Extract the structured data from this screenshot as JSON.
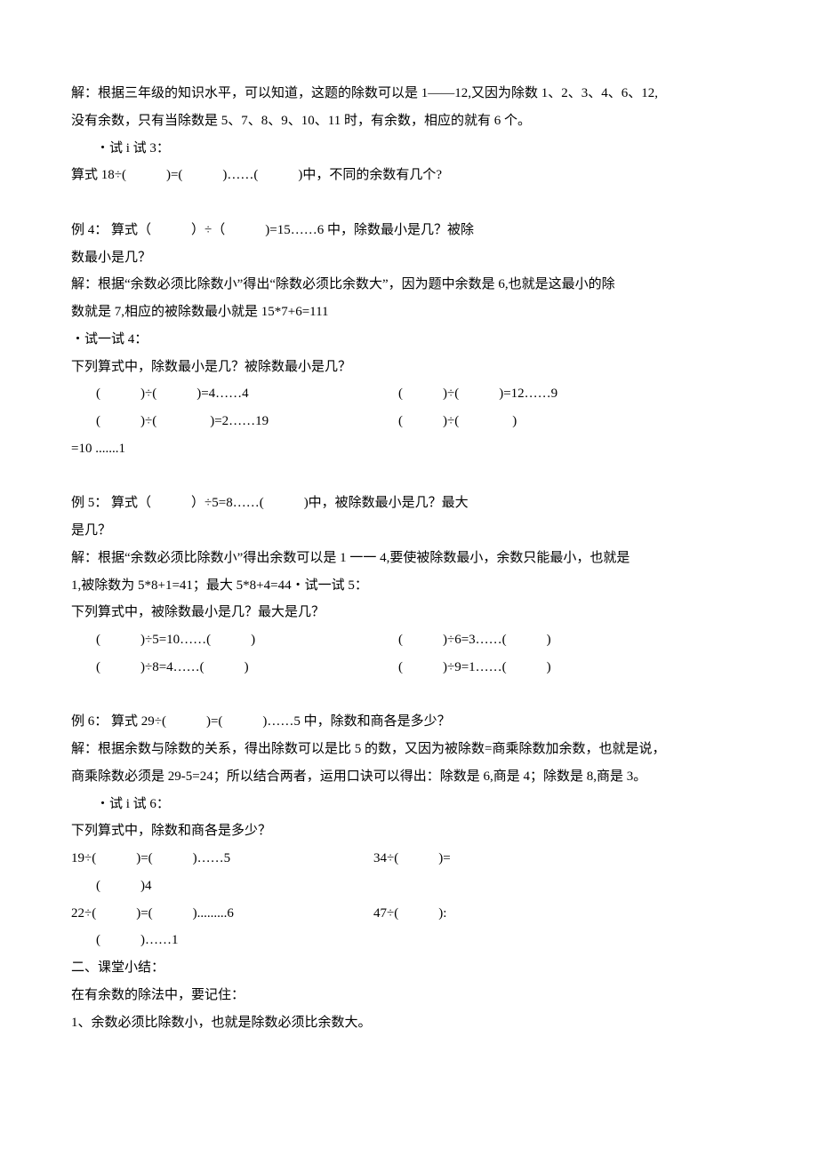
{
  "p01": "解：根据三年级的知识水平，可以知道，这题的除数可以是 1——12,又因为除数 1、2、3、4、6、12,",
  "p02": "没有余数，只有当除数是 5、7、8、9、10、11 时，有余数，相应的就有 6 个。",
  "p03": "・试 i 试 3：",
  "p04": "算式 18÷(　　　)=(　　　)……(　　　)中，不同的余数有几个?",
  "p05": "例 4： 算式（　　　）÷（　　　)=15……6 中，除数最小是几？被除",
  "p06": "数最小是几？",
  "p07": "解：根据“余数必须比除数小”得出“除数必须比余数大”，因为题中余数是 6,也就是这最小的除",
  "p08": "数就是 7,相应的被除数最小就是 15*7+6=111",
  "p09": "・试一试 4：",
  "p10": "下列算式中，除数最小是几？被除数最小是几？",
  "row1a": "(　　　)÷(　　　)=4……4",
  "row1b": "(　　　)÷(　　　)=12……9",
  "row2a": "(　　　)÷(　　　　)=2……19",
  "row2b": "(　　　)÷(　　　　)",
  "p11": "=10 .......1",
  "p12": "例 5： 算式（　　　）÷5=8……(　　　)中，被除数最小是几？最大",
  "p13": "是几？",
  "p14": "解：根据“余数必须比除数小”得出余数可以是 1 一一 4,要使被除数最小，余数只能最小，也就是",
  "p15": "1,被除数为 5*8+1=41；最大 5*8+4=44・试一试 5：",
  "p16": "下列算式中，被除数最小是几？最大是几？",
  "row3a": "(　　　)÷5=10……(　　　)",
  "row3b": "(　　　)÷6=3……(　　　)",
  "row4a": "(　　　)÷8=4……(　　　)",
  "row4b": "(　　　)÷9=1……(　　　)",
  "p17": "例 6： 算式 29÷(　　　)=(　　　)……5 中，除数和商各是多少？",
  "p18": "解：根据余数与除数的关系，得出除数可以是比 5 的数，又因为被除数=商乘除数加余数，也就是说，",
  "p19": "商乘除数必须是 29-5=24；所以结合两者，运用口诀可以得出：除数是 6,商是 4；除数是 8,商是 3。",
  "p20": "・试 i 试 6：",
  "p21": "下列算式中，除数和商各是多少？",
  "row5a": "19÷(　　　)=(　　　)……5",
  "row5b": "34÷(　　　)=",
  "p22": "(　　　)4",
  "row6a": "22÷(　　　)=(　　　).........6",
  "row6b": "47÷(　　　):",
  "p23": "(　　　)……1",
  "p24": "二、课堂小结：",
  "p25": "在有余数的除法中，要记住：",
  "p26": "1、余数必须比除数小，也就是除数必须比余数大。"
}
